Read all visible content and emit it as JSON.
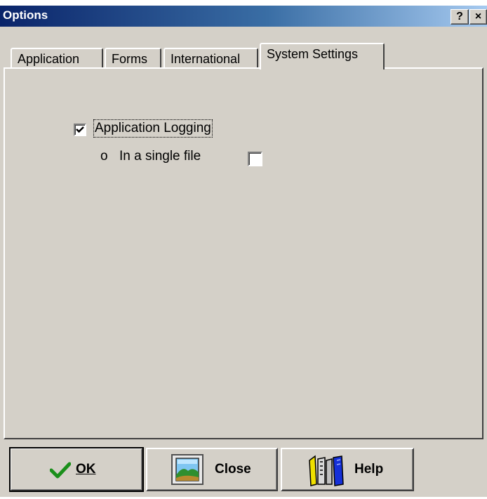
{
  "window": {
    "title": "Options"
  },
  "titlebar_buttons": {
    "help": "?",
    "close": "×"
  },
  "tabs": [
    {
      "label": "Application"
    },
    {
      "label": "Forms"
    },
    {
      "label": "International"
    },
    {
      "label": "System Settings",
      "selected": true
    }
  ],
  "system_settings": {
    "application_logging": {
      "label": "Application Logging",
      "checked": true
    },
    "single_file": {
      "bullet": "o",
      "label": "In a single file",
      "checked": false
    }
  },
  "buttons": {
    "ok": {
      "label": "OK",
      "icon": "checkmark-icon"
    },
    "close": {
      "label": "Close",
      "icon": "picture-frame-icon"
    },
    "help": {
      "label": "Help",
      "icon": "books-icon"
    }
  },
  "colors": {
    "face": "#d4d0c8",
    "title_start": "#0a246a",
    "title_end": "#a6caf0",
    "check_green": "#1a8f1a"
  }
}
